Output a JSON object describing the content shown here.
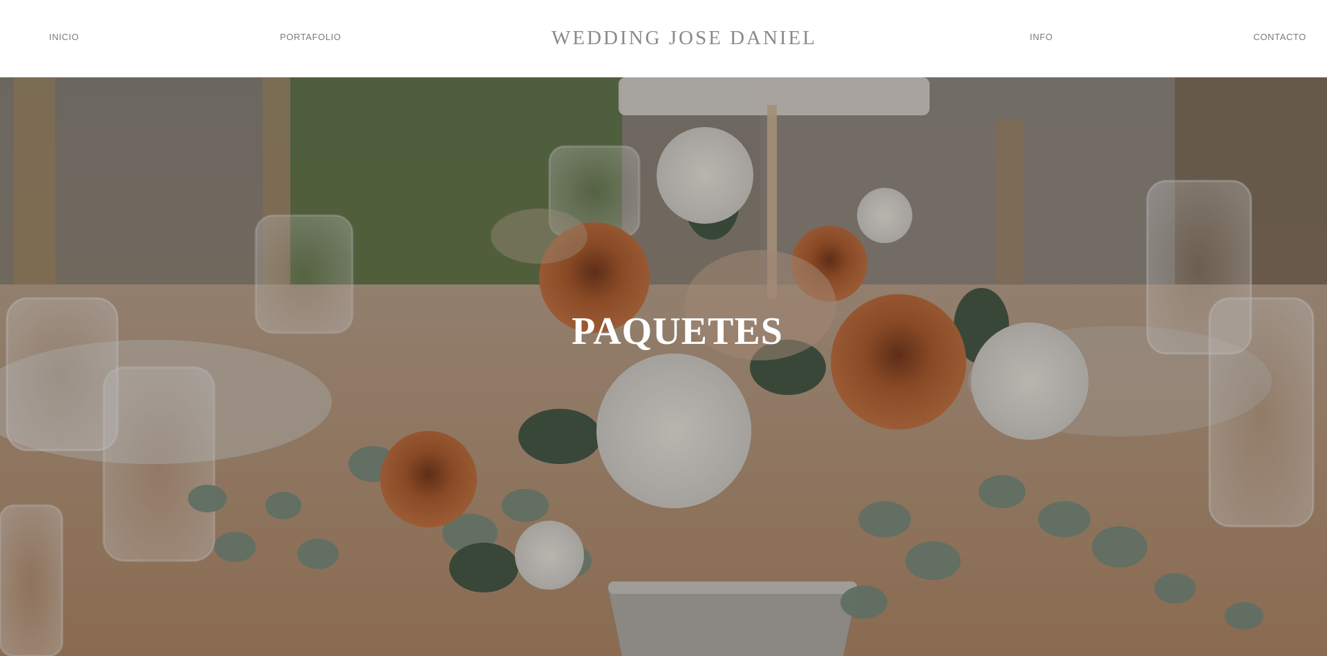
{
  "nav": {
    "inicio": "INICIO",
    "portafolio": "PORTAFOLIO",
    "info": "INFO",
    "contacto": "CONTACTO"
  },
  "site_title": "WEDDING JOSE DANIEL",
  "hero": {
    "title": "PAQUETES"
  },
  "colors": {
    "nav_text": "#7a7a7a",
    "title_text": "#8a8a8a",
    "hero_text": "#ffffff",
    "rose_orange": "#b8643a",
    "foliage_green": "#6f8a74",
    "tablecloth": "#c9a582"
  }
}
